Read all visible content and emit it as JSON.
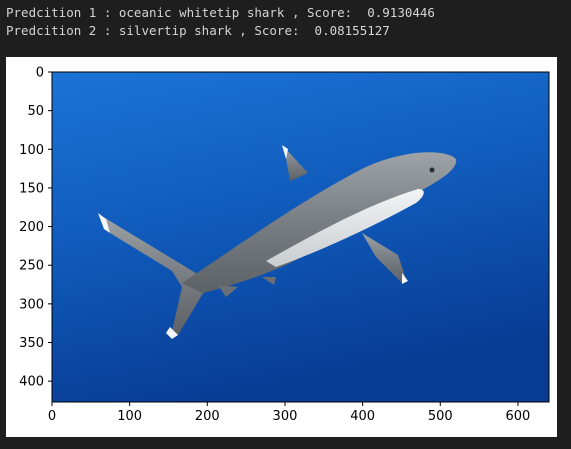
{
  "console": {
    "prediction_1": "Predcition 1 : oceanic whitetip shark , Score:  0.9130446",
    "prediction_2": "Predcition 2 : silvertip shark , Score:  0.08155127"
  },
  "plot": {
    "image_subject": "shark-photo",
    "x_ticks": [
      "0",
      "100",
      "200",
      "300",
      "400",
      "500",
      "600"
    ],
    "y_ticks": [
      "0",
      "50",
      "100",
      "150",
      "200",
      "250",
      "300",
      "350",
      "400"
    ],
    "x_range": [
      0,
      640
    ],
    "y_range": [
      0,
      427
    ],
    "colors": {
      "water_top": "#1a6fd1",
      "water_bottom": "#0a3f9a",
      "shark_body": "#8a8f93",
      "shark_belly": "#e6e8ea",
      "fin_tip": "#f4f6f8"
    }
  }
}
